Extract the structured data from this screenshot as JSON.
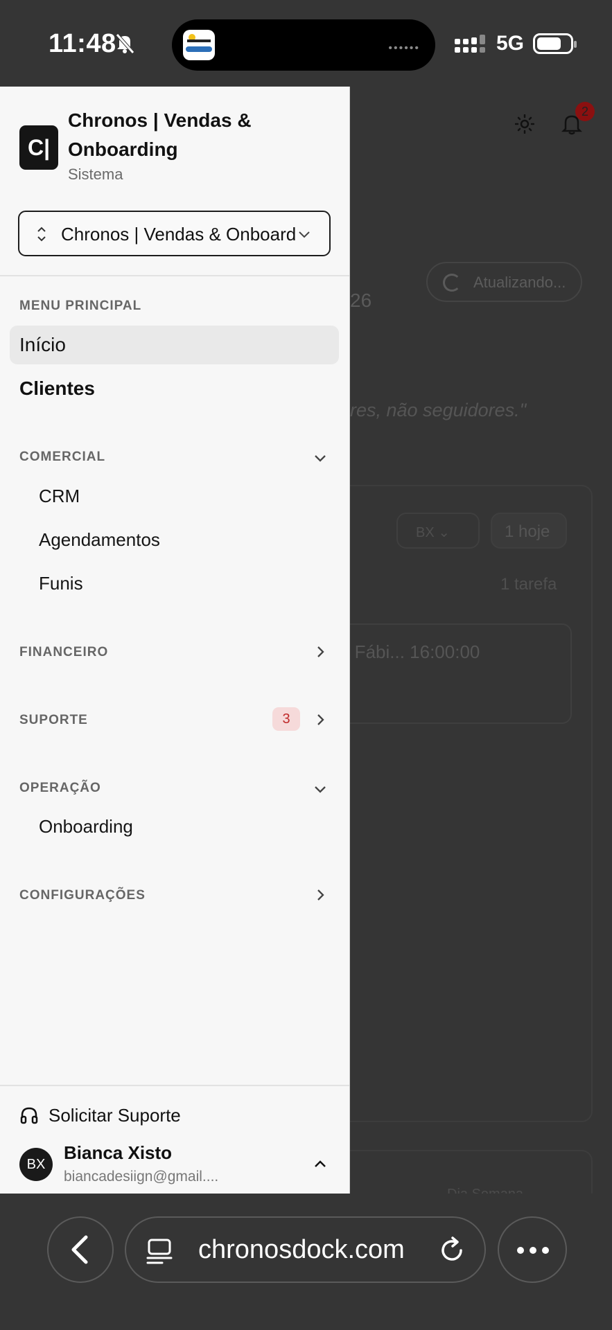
{
  "status_bar": {
    "time": "11:48",
    "network": "5G"
  },
  "background": {
    "notification_count": "2",
    "updating_label": "Atualizando...",
    "year_fragment": "26",
    "quote_fragment": "res, não seguidores.\"",
    "assignee_value": "BX",
    "today_button": "1 hoje",
    "task_count": "1 tarefa",
    "task_text": "g Fábi...  16:00:00",
    "bottom_fragment": "Dia   Semana"
  },
  "drawer": {
    "logo_text": "C|",
    "org_name": "Chronos | Vendas & Onboarding",
    "org_subtitle": "Sistema",
    "switcher_value": "Chronos | Vendas & Onboard",
    "main_menu": {
      "title": "MENU PRINCIPAL",
      "items": [
        "Início",
        "Clientes"
      ]
    },
    "comercial": {
      "title": "COMERCIAL",
      "items": [
        "CRM",
        "Agendamentos",
        "Funis"
      ]
    },
    "financeiro": {
      "title": "FINANCEIRO"
    },
    "suporte": {
      "title": "SUPORTE",
      "badge": "3"
    },
    "operacao": {
      "title": "OPERAÇÃO",
      "items": [
        "Onboarding"
      ]
    },
    "configuracoes": {
      "title": "CONFIGURAÇÕES"
    },
    "support_link": "Solicitar Suporte",
    "user": {
      "initials": "BX",
      "name": "Bianca Xisto",
      "email": "biancadesiign@gmail...."
    }
  },
  "browser": {
    "url": "chronosdock.com"
  },
  "colors": {
    "drawer_bg": "#f7f7f7",
    "overlay": "#353535",
    "badge_red": "#c02a2a"
  }
}
